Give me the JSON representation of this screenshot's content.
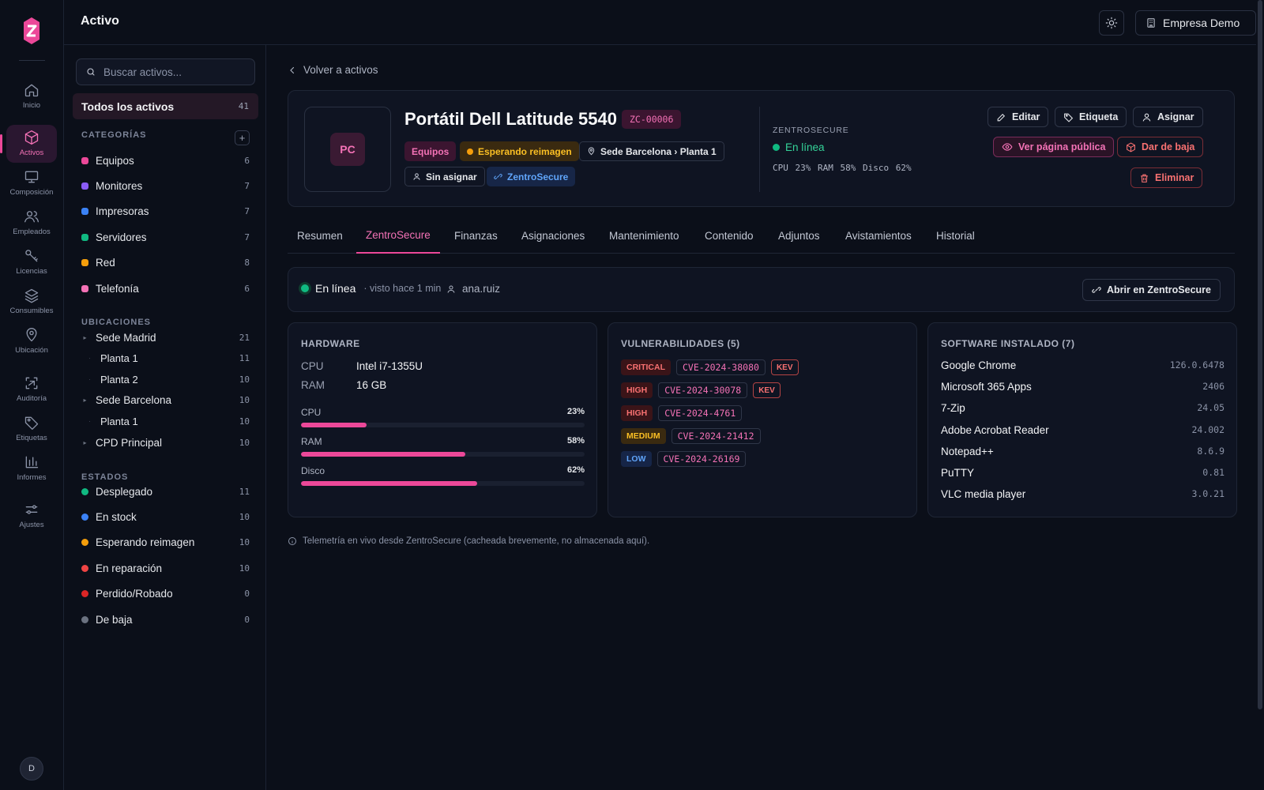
{
  "app": {
    "title": "Activo",
    "company": "Empresa Demo",
    "user_initial": "D"
  },
  "nav": [
    {
      "label": "Inicio",
      "icon": "home-icon"
    },
    {
      "label": "Activos",
      "icon": "box-icon",
      "active": true
    },
    {
      "label": "Composición",
      "icon": "monitor-icon"
    },
    {
      "label": "Empleados",
      "icon": "users-icon"
    },
    {
      "label": "Licencias",
      "icon": "key-icon"
    },
    {
      "label": "Consumibles",
      "icon": "layers-icon"
    },
    {
      "label": "Ubicación",
      "icon": "map-pin-icon"
    },
    {
      "label": "Auditoría",
      "icon": "scan-icon"
    },
    {
      "label": "Etiquetas",
      "icon": "tag-icon"
    },
    {
      "label": "Informes",
      "icon": "bar-chart-icon"
    },
    {
      "label": "Ajustes",
      "icon": "sliders-icon"
    }
  ],
  "sidebar": {
    "search_placeholder": "Buscar activos...",
    "all_assets": {
      "label": "Todos los activos",
      "count": "41"
    },
    "categories_title": "CATEGORÍAS",
    "categories": [
      {
        "label": "Equipos",
        "count": "6",
        "color": "#ec4899"
      },
      {
        "label": "Monitores",
        "count": "7",
        "color": "#8b5cf6"
      },
      {
        "label": "Impresoras",
        "count": "7",
        "color": "#3b82f6"
      },
      {
        "label": "Servidores",
        "count": "7",
        "color": "#10b981"
      },
      {
        "label": "Red",
        "count": "8",
        "color": "#f59e0b"
      },
      {
        "label": "Telefonía",
        "count": "6",
        "color": "#f472b6"
      }
    ],
    "locations_title": "UBICACIONES",
    "locations": [
      {
        "label": "Sede Madrid",
        "count": "21",
        "sub": false
      },
      {
        "label": "Planta 1",
        "count": "11",
        "sub": true
      },
      {
        "label": "Planta 2",
        "count": "10",
        "sub": true
      },
      {
        "label": "Sede Barcelona",
        "count": "10",
        "sub": false
      },
      {
        "label": "Planta 1",
        "count": "10",
        "sub": true
      },
      {
        "label": "CPD Principal",
        "count": "10",
        "sub": false
      }
    ],
    "states_title": "ESTADOS",
    "states": [
      {
        "label": "Desplegado",
        "count": "11",
        "color": "#10b981"
      },
      {
        "label": "En stock",
        "count": "10",
        "color": "#3b82f6"
      },
      {
        "label": "Esperando reimagen",
        "count": "10",
        "color": "#f59e0b"
      },
      {
        "label": "En reparación",
        "count": "10",
        "color": "#ef4444"
      },
      {
        "label": "Perdido/Robado",
        "count": "0",
        "color": "#dc2626"
      },
      {
        "label": "De baja",
        "count": "0",
        "color": "#6b7280"
      }
    ]
  },
  "asset": {
    "back_label": "Volver a activos",
    "thumb": "PC",
    "name": "Portátil Dell Latitude 5540",
    "code": "ZC-00006",
    "category": "Equipos",
    "status": "Esperando reimagen",
    "location": "Sede Barcelona › Planta 1",
    "assignee": "Sin asignar",
    "integration": "ZentroSecure",
    "zs_label": "ZENTROSECURE",
    "zs_online": "En línea",
    "zs_metrics": "CPU 23% RAM 58% Disco 62%",
    "actions": {
      "edit": "Editar",
      "tag": "Etiqueta",
      "assign": "Asignar",
      "public": "Ver página pública",
      "retire": "Dar de baja",
      "delete": "Eliminar"
    }
  },
  "tabs": [
    "Resumen",
    "ZentroSecure",
    "Finanzas",
    "Asignaciones",
    "Mantenimiento",
    "Contenido",
    "Adjuntos",
    "Avistamientos",
    "Historial"
  ],
  "status_bar": {
    "online": "En línea",
    "seen": "· visto hace 1 min",
    "user": "ana.ruiz",
    "open_button": "Abrir en ZentroSecure"
  },
  "hardware": {
    "title": "HARDWARE",
    "specs": [
      {
        "k": "CPU",
        "v": "Intel i7-1355U"
      },
      {
        "k": "RAM",
        "v": "16 GB"
      }
    ],
    "usage": [
      {
        "label": "CPU",
        "value": 23,
        "text": "23%"
      },
      {
        "label": "RAM",
        "value": 58,
        "text": "58%"
      },
      {
        "label": "Disco",
        "value": 62,
        "text": "62%"
      }
    ]
  },
  "vulnerabilities": {
    "title": "VULNERABILIDADES (5)",
    "items": [
      {
        "severity": "CRITICAL",
        "cve": "CVE-2024-38080",
        "kev": "KEV"
      },
      {
        "severity": "HIGH",
        "cve": "CVE-2024-30078",
        "kev": "KEV"
      },
      {
        "severity": "HIGH",
        "cve": "CVE-2024-4761",
        "kev": ""
      },
      {
        "severity": "MEDIUM",
        "cve": "CVE-2024-21412",
        "kev": ""
      },
      {
        "severity": "LOW",
        "cve": "CVE-2024-26169",
        "kev": ""
      }
    ]
  },
  "software": {
    "title": "SOFTWARE INSTALADO (7)",
    "items": [
      {
        "name": "Google Chrome",
        "version": "126.0.6478"
      },
      {
        "name": "Microsoft 365 Apps",
        "version": "2406"
      },
      {
        "name": "7-Zip",
        "version": "24.05"
      },
      {
        "name": "Adobe Acrobat Reader",
        "version": "24.002"
      },
      {
        "name": "Notepad++",
        "version": "8.6.9"
      },
      {
        "name": "PuTTY",
        "version": "0.81"
      },
      {
        "name": "VLC media player",
        "version": "3.0.21"
      }
    ]
  },
  "footnote": "Telemetría en vivo desde ZentroSecure (cacheada brevemente, no almacenada aquí)."
}
